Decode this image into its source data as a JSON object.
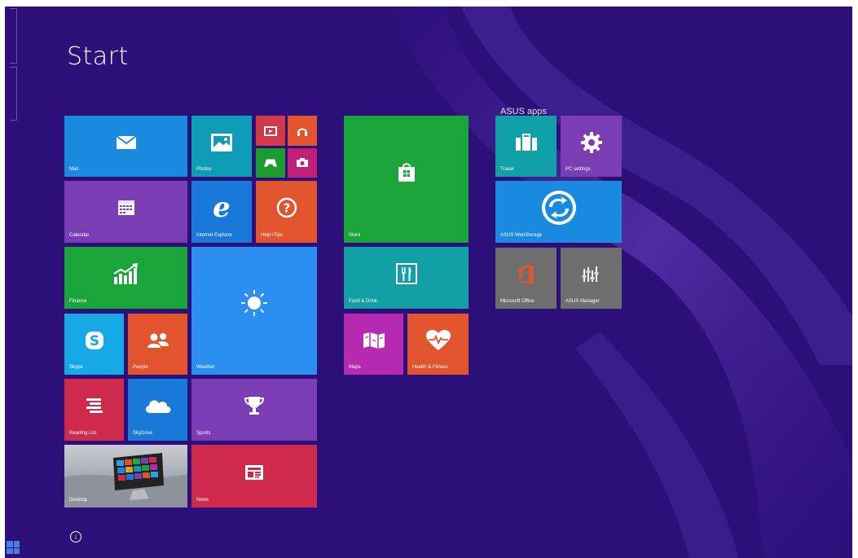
{
  "start": {
    "title": "Start",
    "all_apps_glyph": "↓"
  },
  "groups": {
    "asus_title": "ASUS apps"
  },
  "tiles": {
    "mail": {
      "label": "Mail",
      "color": "#1a8ae0",
      "icon": "mail-icon"
    },
    "photos": {
      "label": "Photos",
      "color": "#0e9db7",
      "icon": "photos-icon"
    },
    "video": {
      "label": "",
      "color": "#d23948",
      "icon": "video-icon"
    },
    "music": {
      "label": "",
      "color": "#e2542d",
      "icon": "headphones-icon"
    },
    "games": {
      "label": "",
      "color": "#1c9a32",
      "icon": "gamepad-icon"
    },
    "camera": {
      "label": "",
      "color": "#c0207a",
      "icon": "camera-icon"
    },
    "calendar": {
      "label": "Calendar",
      "color": "#7a3db3",
      "icon": "calendar-icon"
    },
    "ie": {
      "label": "Internet Explorer",
      "color": "#1979d8",
      "icon": "ie-icon"
    },
    "help": {
      "label": "Help+Tips",
      "color": "#e2542d",
      "icon": "help-icon"
    },
    "store": {
      "label": "Store",
      "color": "#1aa53b",
      "icon": "store-icon"
    },
    "finance": {
      "label": "Finance",
      "color": "#1aa53b",
      "icon": "finance-icon"
    },
    "weather": {
      "label": "Weather",
      "color": "#2a8ff0",
      "icon": "sun-icon"
    },
    "food": {
      "label": "Food & Drink",
      "color": "#10a0a6",
      "icon": "food-icon"
    },
    "skype": {
      "label": "Skype",
      "color": "#17a8e6",
      "icon": "skype-icon"
    },
    "people": {
      "label": "People",
      "color": "#e2542d",
      "icon": "people-icon"
    },
    "maps": {
      "label": "Maps",
      "color": "#b42bb2",
      "icon": "maps-icon"
    },
    "health": {
      "label": "Health & Fitness",
      "color": "#e2542d",
      "icon": "heart-icon"
    },
    "reading": {
      "label": "Reading List",
      "color": "#cf2a4b",
      "icon": "reading-list-icon"
    },
    "skydrive": {
      "label": "SkyDrive",
      "color": "#1979d8",
      "icon": "cloud-icon"
    },
    "sports": {
      "label": "Sports",
      "color": "#7a3db3",
      "icon": "trophy-icon"
    },
    "desktop": {
      "label": "Desktop",
      "color": "#8a8f98",
      "icon": "desktop-image"
    },
    "news": {
      "label": "News",
      "color": "#cf2a4b",
      "icon": "news-icon"
    },
    "travel": {
      "label": "Travel",
      "color": "#12a0a8",
      "icon": "suitcase-icon"
    },
    "pcsettings": {
      "label": "PC settings",
      "color": "#7a3db3",
      "icon": "gear-icon"
    },
    "webstorage": {
      "label": "ASUS WebStorage",
      "color": "#1a8ae0",
      "icon": "sync-icon"
    },
    "office": {
      "label": "Microsoft Office",
      "color": "#6e6e6e",
      "icon": "office-icon"
    },
    "asusmanager": {
      "label": "ASUS Manager",
      "color": "#6e6e6e",
      "icon": "asus-manager-icon"
    }
  }
}
